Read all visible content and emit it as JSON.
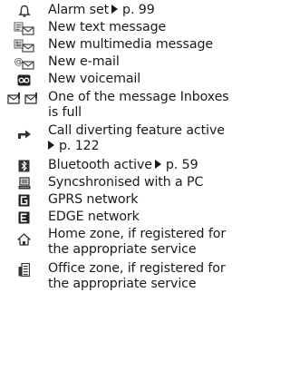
{
  "items": [
    {
      "icon": "alarm-bell-icon",
      "lines": [
        {
          "text": "Alarm set",
          "ref": "p. 99"
        }
      ]
    },
    {
      "icon": "new-text-message-icon",
      "lines": [
        {
          "text": "New text message"
        }
      ]
    },
    {
      "icon": "new-multimedia-message-icon",
      "lines": [
        {
          "text": "New multimedia message"
        }
      ]
    },
    {
      "icon": "new-email-icon",
      "lines": [
        {
          "text": "New e-mail"
        }
      ]
    },
    {
      "icon": "voicemail-icon",
      "lines": [
        {
          "text": "New voicemail"
        }
      ]
    },
    {
      "icon": "inbox-full-icon",
      "lines": [
        {
          "text": "One of the message Inboxes"
        },
        {
          "text": "is full"
        }
      ]
    },
    {
      "icon": "call-diverting-icon",
      "lines": [
        {
          "text": "Call diverting feature active"
        },
        {
          "text": "",
          "ref": "p. 122"
        }
      ]
    },
    {
      "icon": "bluetooth-icon",
      "lines": [
        {
          "text": "Bluetooth active",
          "ref": "p. 59"
        }
      ]
    },
    {
      "icon": "pc-sync-icon",
      "lines": [
        {
          "text": "Syncshronised with a PC"
        }
      ]
    },
    {
      "icon": "gprs-network-icon",
      "lines": [
        {
          "text": "GPRS network"
        }
      ]
    },
    {
      "icon": "edge-network-icon",
      "lines": [
        {
          "text": "EDGE network"
        }
      ]
    },
    {
      "icon": "home-zone-icon",
      "lines": [
        {
          "text": "Home zone, if registered for"
        },
        {
          "text": "the appropriate service"
        }
      ]
    },
    {
      "icon": "office-zone-icon",
      "lines": [
        {
          "text": "Office zone, if registered for"
        },
        {
          "text": "the appropriate service"
        }
      ]
    }
  ]
}
